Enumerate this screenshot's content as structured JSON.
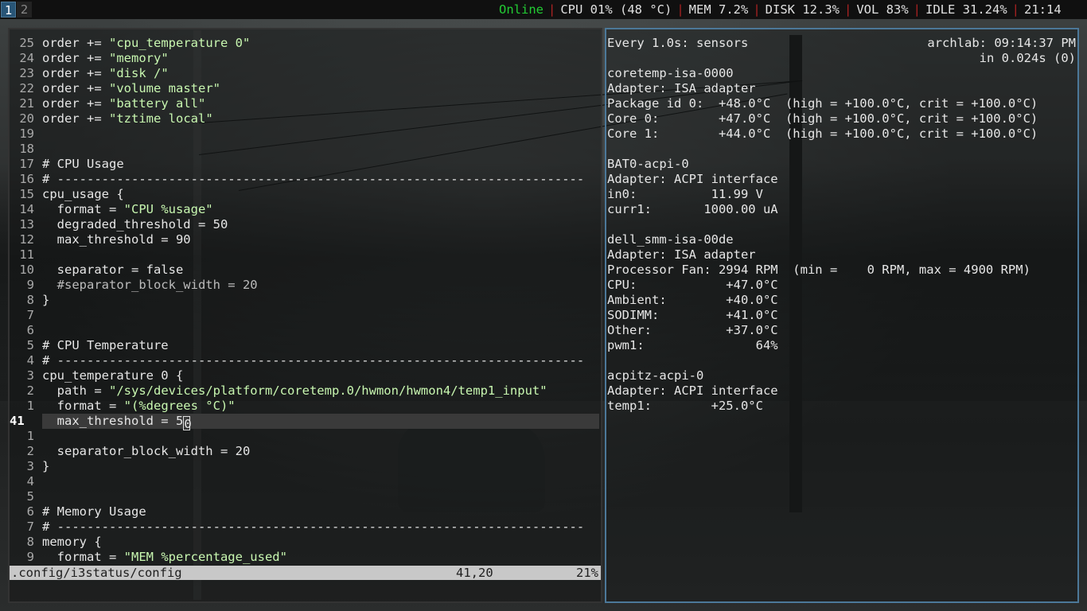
{
  "workspaces": [
    {
      "label": "1",
      "active": true
    },
    {
      "label": "2",
      "active": false
    }
  ],
  "status_bar": {
    "online": "Online",
    "cpu": "CPU 01% (48 °C)",
    "mem": "MEM 7.2%",
    "disk": "DISK 12.3%",
    "vol": "VOL 83%",
    "idle": "IDLE 31.24%",
    "time": "21:14"
  },
  "editor": {
    "lines": [
      {
        "num": "25",
        "text": "order += \"cpu_temperature 0\""
      },
      {
        "num": "24",
        "text": "order += \"memory\""
      },
      {
        "num": "23",
        "text": "order += \"disk /\""
      },
      {
        "num": "22",
        "text": "order += \"volume master\""
      },
      {
        "num": "21",
        "text": "order += \"battery all\""
      },
      {
        "num": "20",
        "text": "order += \"tztime local\""
      },
      {
        "num": "19",
        "text": ""
      },
      {
        "num": "18",
        "text": ""
      },
      {
        "num": "17",
        "text": "# CPU Usage"
      },
      {
        "num": "16",
        "text": "# -----------------------------------------------------------------------"
      },
      {
        "num": "15",
        "text": "cpu_usage {"
      },
      {
        "num": "14",
        "text": "  format = \"CPU %usage\""
      },
      {
        "num": "13",
        "text": "  degraded_threshold = 50"
      },
      {
        "num": "12",
        "text": "  max_threshold = 90"
      },
      {
        "num": "11",
        "text": ""
      },
      {
        "num": "10",
        "text": "  separator = false"
      },
      {
        "num": "9",
        "text": "  #separator_block_width = 20"
      },
      {
        "num": "8",
        "text": "}"
      },
      {
        "num": "7",
        "text": ""
      },
      {
        "num": "6",
        "text": ""
      },
      {
        "num": "5",
        "text": "# CPU Temperature"
      },
      {
        "num": "4",
        "text": "# -----------------------------------------------------------------------"
      },
      {
        "num": "3",
        "text": "cpu_temperature 0 {"
      },
      {
        "num": "2",
        "text": "  path = \"/sys/devices/platform/coretemp.0/hwmon/hwmon4/temp1_input\""
      },
      {
        "num": "1",
        "text": "  format = \"(%degrees °C)\""
      },
      {
        "num": "41",
        "text": "  max_threshold = 50",
        "current": true
      },
      {
        "num": "1",
        "text": ""
      },
      {
        "num": "2",
        "text": "  separator_block_width = 20"
      },
      {
        "num": "3",
        "text": "}"
      },
      {
        "num": "4",
        "text": ""
      },
      {
        "num": "5",
        "text": ""
      },
      {
        "num": "6",
        "text": "# Memory Usage"
      },
      {
        "num": "7",
        "text": "# -----------------------------------------------------------------------"
      },
      {
        "num": "8",
        "text": "memory {"
      },
      {
        "num": "9",
        "text": "  format = \"MEM %percentage_used\""
      }
    ],
    "status": {
      "file": ".config/i3status/config",
      "position": "41,20",
      "percent": "21%"
    }
  },
  "terminal": {
    "header_left": "Every 1.0s: sensors",
    "header_right": "archlab: 09:14:37 PM",
    "header_right2": "in 0.024s (0)",
    "lines": [
      "",
      "coretemp-isa-0000",
      "Adapter: ISA adapter",
      "Package id 0:  +48.0°C  (high = +100.0°C, crit = +100.0°C)",
      "Core 0:        +47.0°C  (high = +100.0°C, crit = +100.0°C)",
      "Core 1:        +44.0°C  (high = +100.0°C, crit = +100.0°C)",
      "",
      "BAT0-acpi-0",
      "Adapter: ACPI interface",
      "in0:          11.99 V",
      "curr1:       1000.00 uA",
      "",
      "dell_smm-isa-00de",
      "Adapter: ISA adapter",
      "Processor Fan: 2994 RPM  (min =    0 RPM, max = 4900 RPM)",
      "CPU:            +47.0°C",
      "Ambient:        +40.0°C",
      "SODIMM:         +41.0°C",
      "Other:          +37.0°C",
      "pwm1:               64%",
      "",
      "acpitz-acpi-0",
      "Adapter: ACPI interface",
      "temp1:        +25.0°C"
    ]
  }
}
